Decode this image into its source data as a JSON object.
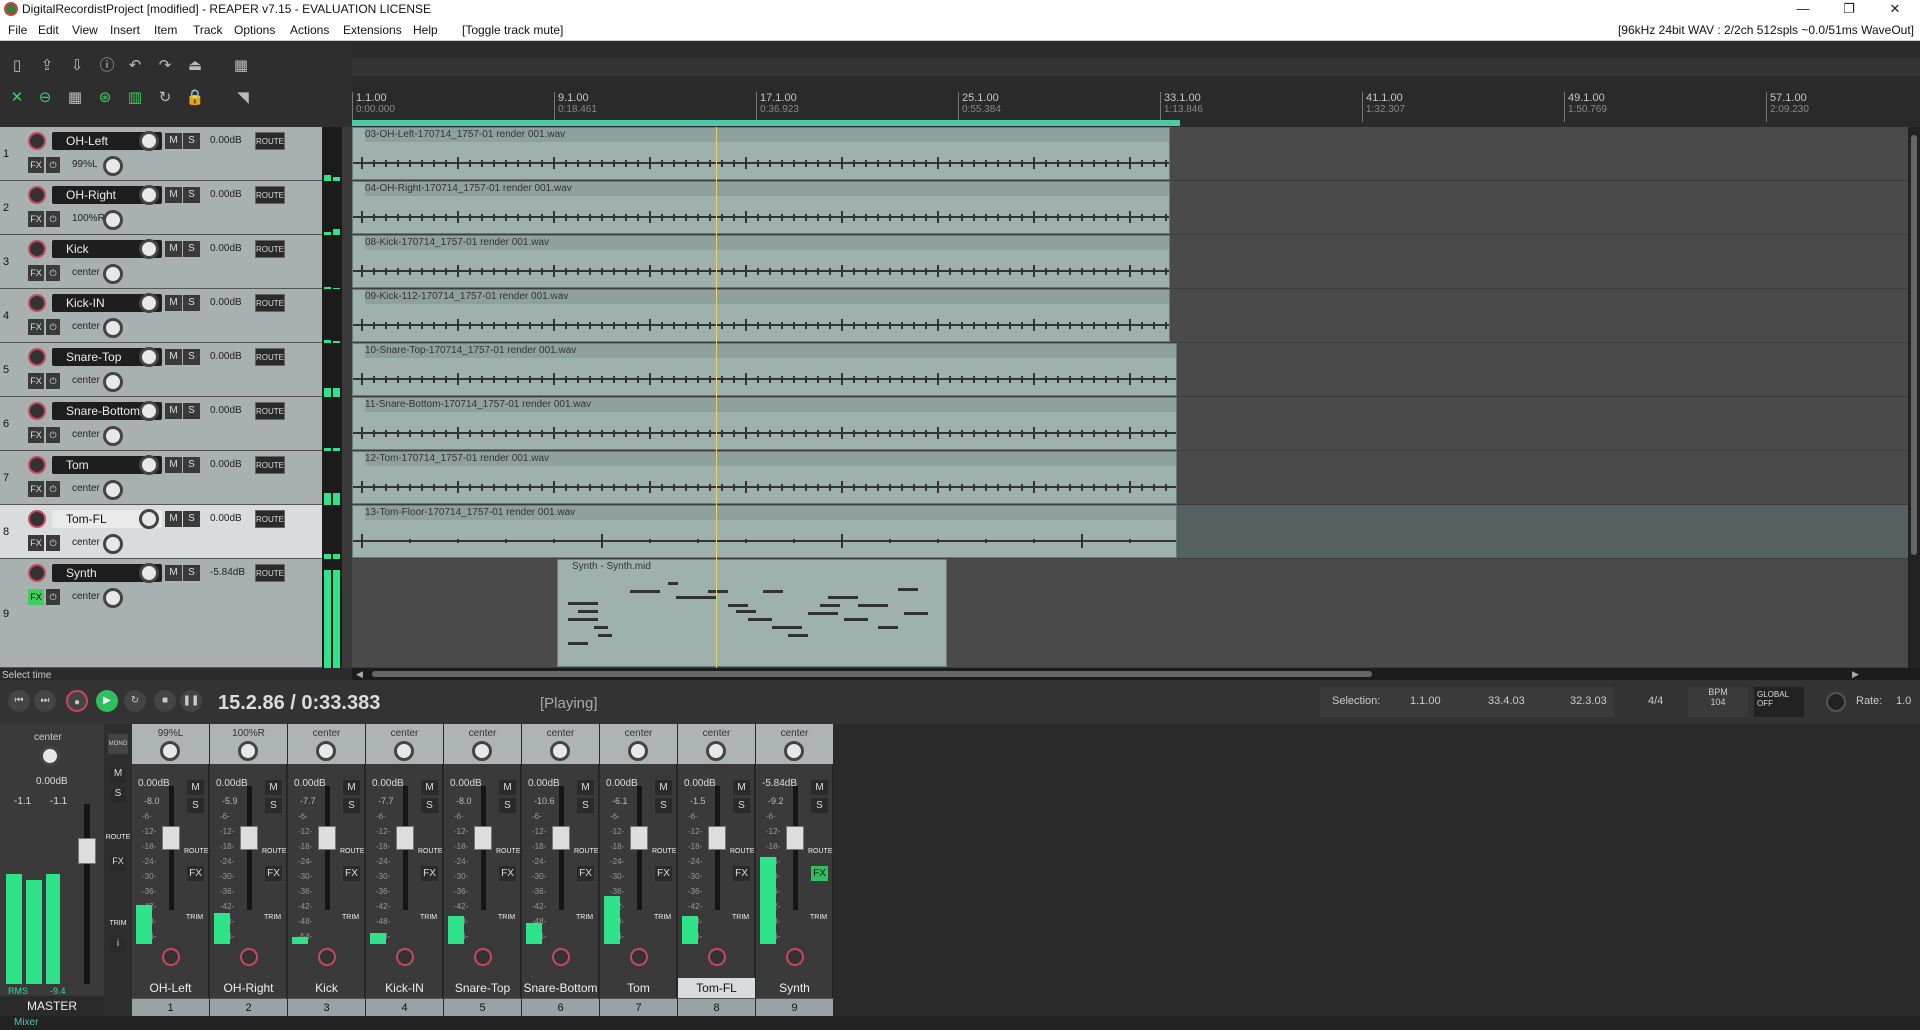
{
  "window": {
    "title": "DigitalRecordistProject [modified] - REAPER v7.15 - EVALUATION LICENSE",
    "minimize": "—",
    "maximize": "❐",
    "close": "✕"
  },
  "menu": {
    "items": [
      "File",
      "Edit",
      "View",
      "Insert",
      "Item",
      "Track",
      "Options",
      "Actions",
      "Extensions",
      "Help"
    ],
    "action_hint": "[Toggle track mute]",
    "audio_status": "[96kHz 24bit WAV : 2/2ch 512spls ~0.0/51ms WaveOut]"
  },
  "ruler": {
    "ticks": [
      {
        "bar": "1.1.00",
        "time": "0:00.000"
      },
      {
        "bar": "9.1.00",
        "time": "0:18.461"
      },
      {
        "bar": "17.1.00",
        "time": "0:36.923"
      },
      {
        "bar": "25.1.00",
        "time": "0:55.384"
      },
      {
        "bar": "33.1.00",
        "time": "1:13.846"
      },
      {
        "bar": "41.1.00",
        "time": "1:32.307"
      },
      {
        "bar": "49.1.00",
        "time": "1:50.769"
      },
      {
        "bar": "57.1.00",
        "time": "2:09.230"
      }
    ]
  },
  "tracks": [
    {
      "num": "1",
      "name": "OH-Left",
      "vol": "0.00dB",
      "pan": "99%L",
      "m": "M",
      "s": "S",
      "route": "ROUTE",
      "fx": "FX",
      "item": "03-OH-Left-170714_1757-01 render 001.wav"
    },
    {
      "num": "2",
      "name": "OH-Right",
      "vol": "0.00dB",
      "pan": "100%R",
      "m": "M",
      "s": "S",
      "route": "ROUTE",
      "fx": "FX",
      "item": "04-OH-Right-170714_1757-01 render 001.wav"
    },
    {
      "num": "3",
      "name": "Kick",
      "vol": "0.00dB",
      "pan": "center",
      "m": "M",
      "s": "S",
      "route": "ROUTE",
      "fx": "FX",
      "item": "08-Kick-170714_1757-01 render 001.wav"
    },
    {
      "num": "4",
      "name": "Kick-IN",
      "vol": "0.00dB",
      "pan": "center",
      "m": "M",
      "s": "S",
      "route": "ROUTE",
      "fx": "FX",
      "item": "09-Kick-112-170714_1757-01 render 001.wav"
    },
    {
      "num": "5",
      "name": "Snare-Top",
      "vol": "0.00dB",
      "pan": "center",
      "m": "M",
      "s": "S",
      "route": "ROUTE",
      "fx": "FX",
      "item": "10-Snare-Top-170714_1757-01 render 001.wav"
    },
    {
      "num": "6",
      "name": "Snare-Bottom",
      "vol": "0.00dB",
      "pan": "center",
      "m": "M",
      "s": "S",
      "route": "ROUTE",
      "fx": "FX",
      "item": "11-Snare-Bottom-170714_1757-01 render 001.wav"
    },
    {
      "num": "7",
      "name": "Tom",
      "vol": "0.00dB",
      "pan": "center",
      "m": "M",
      "s": "S",
      "route": "ROUTE",
      "fx": "FX",
      "item": "12-Tom-170714_1757-01 render 001.wav"
    },
    {
      "num": "8",
      "name": "Tom-FL",
      "vol": "0.00dB",
      "pan": "center",
      "m": "M",
      "s": "S",
      "route": "ROUTE",
      "fx": "FX",
      "item": "13-Tom-Floor-170714_1757-01 render 001.wav"
    },
    {
      "num": "9",
      "name": "Synth",
      "vol": "-5.84dB",
      "pan": "center",
      "m": "M",
      "s": "S",
      "route": "ROUTE",
      "fx": "FX",
      "item": "Synth - Synth.mid"
    }
  ],
  "status_left": "Select time",
  "transport": {
    "position": "15.2.86 / 0:33.383",
    "state": "[Playing]",
    "selection_label": "Selection:",
    "sel_start": "1.1.00",
    "sel_end": "33.4.03",
    "sel_len": "32.3.03",
    "time_sig": "4/4",
    "bpm_label": "BPM",
    "bpm": "104",
    "global_label": "GLOBAL",
    "global_state": "OFF",
    "rate_label": "Rate:",
    "rate": "1.0"
  },
  "mixer": {
    "master": {
      "name": "MASTER",
      "pan": "center",
      "vol": "0.00dB",
      "peak_l": "-1.1",
      "peak_r": "-1.1",
      "rms_label": "RMS",
      "rms": "-9.4",
      "mono": "MONO",
      "m": "M",
      "s": "S",
      "route": "ROUTE",
      "fx": "FX",
      "trim": "TRIM",
      "info": "i"
    },
    "strips": [
      {
        "name": "OH-Left",
        "pan": "99%L",
        "vol": "0.00dB",
        "peak": "-8.0",
        "no": "1",
        "lvl": 0.28
      },
      {
        "name": "OH-Right",
        "pan": "100%R",
        "vol": "0.00dB",
        "peak": "-5.9",
        "no": "2",
        "lvl": 0.22
      },
      {
        "name": "Kick",
        "pan": "center",
        "vol": "0.00dB",
        "peak": "-7.7",
        "no": "3",
        "lvl": 0.05
      },
      {
        "name": "Kick-IN",
        "pan": "center",
        "vol": "0.00dB",
        "peak": "-7.7",
        "no": "4",
        "lvl": 0.08
      },
      {
        "name": "Snare-Top",
        "pan": "center",
        "vol": "0.00dB",
        "peak": "-8.0",
        "no": "5",
        "lvl": 0.2
      },
      {
        "name": "Snare-Bottom",
        "pan": "center",
        "vol": "0.00dB",
        "peak": "-10.6",
        "no": "6",
        "lvl": 0.15
      },
      {
        "name": "Tom",
        "pan": "center",
        "vol": "0.00dB",
        "peak": "-6.1",
        "no": "7",
        "lvl": 0.34
      },
      {
        "name": "Tom-FL",
        "pan": "center",
        "vol": "0.00dB",
        "peak": "-1.5",
        "no": "8",
        "lvl": 0.2
      },
      {
        "name": "Synth",
        "pan": "center",
        "vol": "-5.84dB",
        "peak": "-9.2",
        "no": "9",
        "lvl": 0.62
      }
    ],
    "scale": [
      "-6-",
      "-12-",
      "-18-",
      "-24-",
      "-30-",
      "-36-",
      "-42-",
      "-48-",
      "-54-"
    ],
    "strip_route": "ROUTE",
    "strip_fx": "FX",
    "strip_trim": "TRIM",
    "strip_m": "M",
    "strip_s": "S",
    "mixer_tab": "Mixer"
  },
  "colors": {
    "meter": "#2fe38a",
    "accent": "#4cc9a8",
    "record": "#c9485b",
    "cursor": "#e6d36a"
  }
}
